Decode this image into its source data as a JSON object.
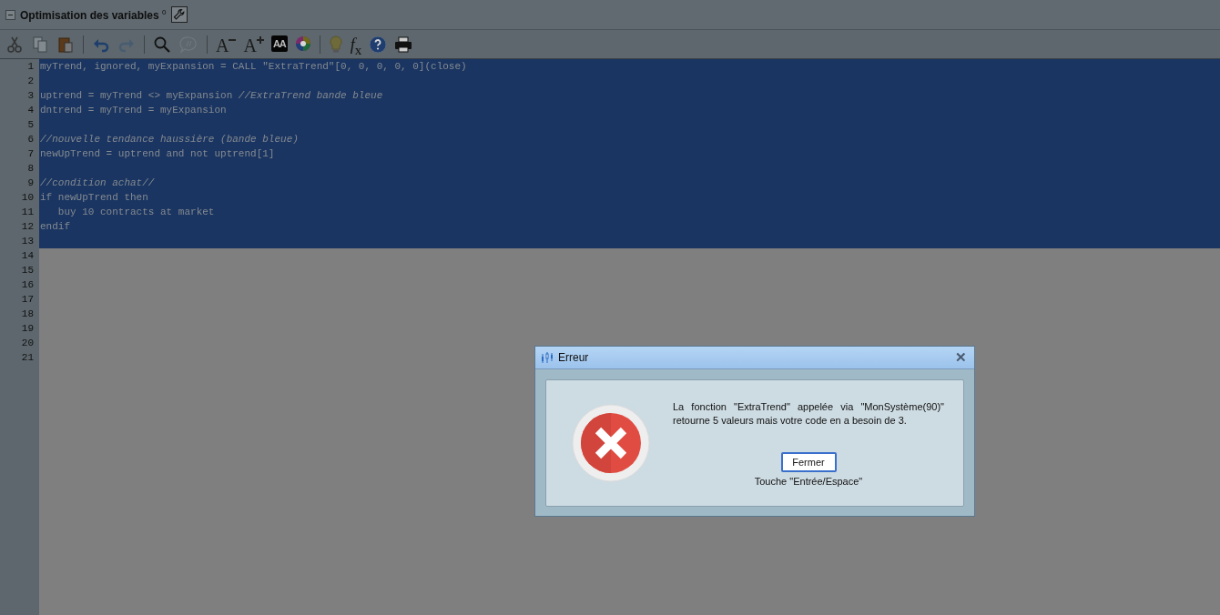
{
  "panel": {
    "title": "Optimisation des variables $^{0}$",
    "expanded": true
  },
  "toolbar": [
    {
      "kind": "cut",
      "disabled": false
    },
    {
      "kind": "copy",
      "disabled": true
    },
    {
      "kind": "paste",
      "disabled": false
    },
    {
      "kind": "separator"
    },
    {
      "kind": "undo",
      "disabled": false
    },
    {
      "kind": "redo",
      "disabled": true
    },
    {
      "kind": "separator"
    },
    {
      "kind": "search",
      "disabled": false
    },
    {
      "kind": "comment",
      "disabled": true
    },
    {
      "kind": "separator"
    },
    {
      "kind": "font-smaller",
      "label": "A",
      "disabled": false
    },
    {
      "kind": "font-larger",
      "label": "A",
      "disabled": false
    },
    {
      "kind": "case",
      "label": "AA",
      "disabled": false
    },
    {
      "kind": "colors",
      "disabled": false
    },
    {
      "kind": "separator"
    },
    {
      "kind": "bulb",
      "disabled": false
    },
    {
      "kind": "function",
      "label": "*f*$_{x}$",
      "disabled": false
    },
    {
      "kind": "help",
      "disabled": false
    },
    {
      "kind": "print",
      "disabled": false
    }
  ],
  "editor": {
    "lines": [
      {
        "number": "1",
        "text": "myTrend, ignored, myExpansion = CALL \"ExtraTrend\"[0, 0, 0, 0, 0](close)",
        "kind": "code",
        "selected": true
      },
      {
        "number": "2",
        "selected": true
      },
      {
        "number": "3",
        "text": "uptrend = myTrend <> myExpansion *//ExtraTrend bande bleue*",
        "kind": "code",
        "selected": true
      },
      {
        "number": "4",
        "text": "dntrend = myTrend = myExpansion",
        "kind": "code",
        "selected": true
      },
      {
        "number": "5",
        "selected": true
      },
      {
        "number": "6",
        "text": "//nouvelle tendance haussière (bande bleue)",
        "kind": "comment",
        "selected": true
      },
      {
        "number": "7",
        "text": "newUpTrend = uptrend and not uptrend[1]",
        "kind": "code",
        "selected": true
      },
      {
        "number": "8",
        "selected": true
      },
      {
        "number": "9",
        "text": "//condition achat//",
        "kind": "comment",
        "selected": true
      },
      {
        "number": "10",
        "text": "if newUpTrend then",
        "kind": "code",
        "selected": true
      },
      {
        "number": "11",
        "text": "   buy 10 contracts at market",
        "kind": "code",
        "selected": true
      },
      {
        "number": "12",
        "text": "endif",
        "kind": "code",
        "selected": true
      },
      {
        "number": "13",
        "selected": true
      },
      {
        "number": "14",
        "selected": false
      },
      {
        "number": "15",
        "selected": false
      },
      {
        "number": "16",
        "selected": false
      },
      {
        "number": "17",
        "selected": false
      },
      {
        "number": "18",
        "selected": false
      },
      {
        "number": "19",
        "selected": false
      },
      {
        "number": "20",
        "selected": false
      },
      {
        "number": "21",
        "selected": false
      }
    ]
  },
  "dialog": {
    "title": "Erreur",
    "close": "✕",
    "message": "La fonction \"ExtraTrend\" appelée via \"MonSystème(90)\" retourne 5 valeurs mais votre code en a besoin de 3.",
    "button": "Fermer",
    "hint": "Touche \"Entrée/Espace\""
  }
}
